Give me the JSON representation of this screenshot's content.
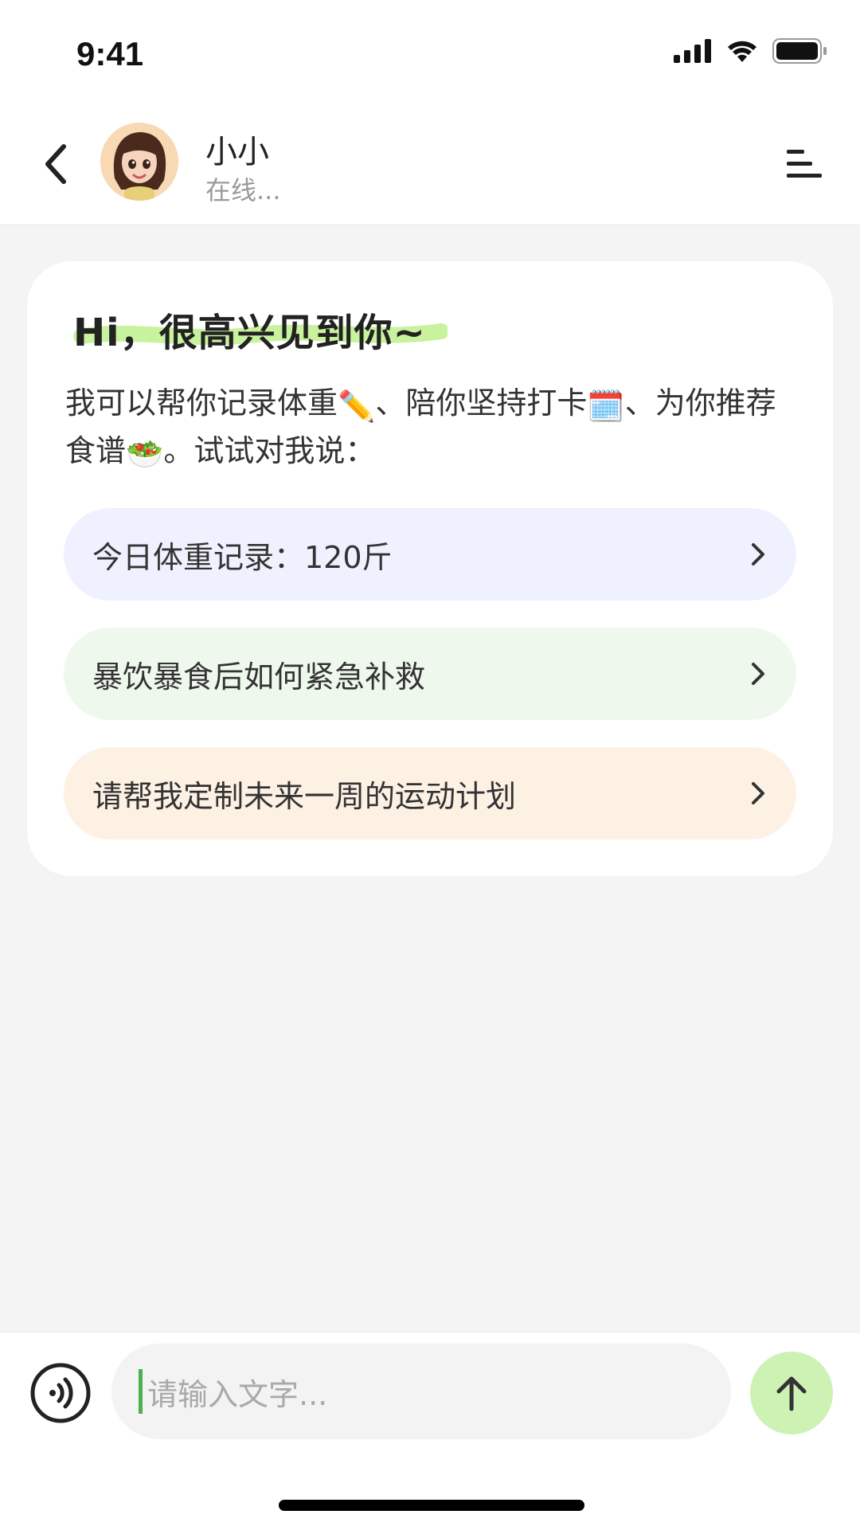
{
  "status_bar": {
    "time": "9:41",
    "icons": [
      "signal-icon",
      "wifi-icon",
      "battery-icon"
    ]
  },
  "header": {
    "back_icon": "chevron-left-icon",
    "name": "小小",
    "status": "在线...",
    "menu_icon": "menu-icon"
  },
  "card": {
    "greeting": "Hi，很高兴见到你~",
    "intro_part1": "我可以帮你记录体重",
    "emoji1": "✏️",
    "intro_part2": "、陪你坚持打卡",
    "emoji2": "🗓️",
    "intro_part3": "、为你推荐食谱",
    "emoji3": "🥗",
    "intro_part4": "。试试对我说：",
    "suggestions": [
      {
        "label": "今日体重记录：120斤",
        "color": "#f0f1ff"
      },
      {
        "label": "暴饮暴食后如何紧急补救",
        "color": "#eff8ed"
      },
      {
        "label": "请帮我定制未来一周的运动计划",
        "color": "#fdf1e4"
      }
    ]
  },
  "input": {
    "placeholder": "请输入文字..."
  },
  "colors": {
    "accent_green": "#cdf2b4",
    "caret": "#4caf50",
    "highlight": "#c9f29e",
    "background": "#f4f4f4"
  }
}
